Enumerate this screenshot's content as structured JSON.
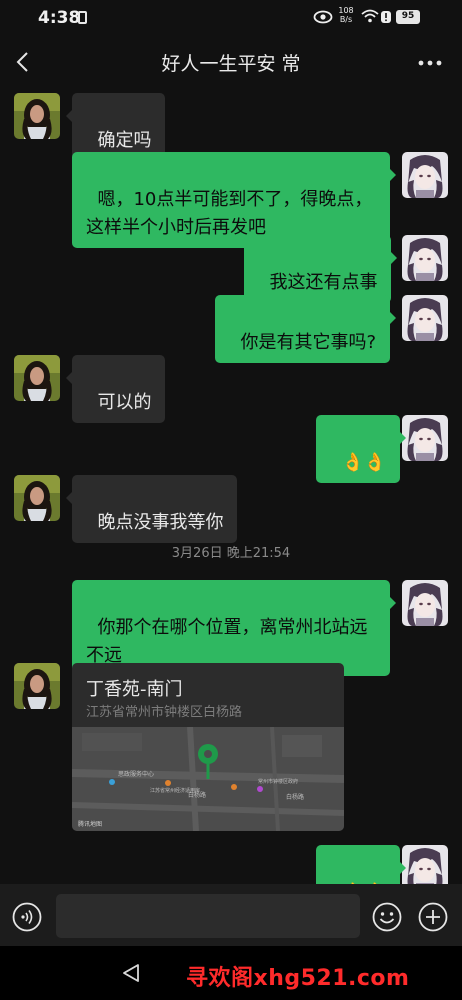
{
  "status_bar": {
    "time": "4:38",
    "net_speed_value": "108",
    "net_speed_unit": "B/s",
    "battery": "95"
  },
  "header": {
    "title": "好人一生平安 常"
  },
  "messages": [
    {
      "side": "in",
      "text": "确定吗"
    },
    {
      "side": "out",
      "text": "嗯，10点半可能到不了，得晚点，\n这样半个小时后再发吧"
    },
    {
      "side": "out",
      "text": "我这还有点事"
    },
    {
      "side": "out",
      "text": "你是有其它事吗?"
    },
    {
      "side": "in",
      "text": "可以的"
    },
    {
      "side": "out",
      "text": "👌👌"
    },
    {
      "side": "in",
      "text": "晚点没事我等你"
    },
    {
      "side": "out",
      "text": "你那个在哪个位置，离常州北站远\n不远"
    },
    {
      "side": "out",
      "text": "👌👌"
    }
  ],
  "timestamp": "3月26日 晚上21:54",
  "location": {
    "name": "丁香苑-南门",
    "address": "江苏省常州市钟楼区白杨路",
    "map_labels": [
      "思政服务中心",
      "江苏省常州经济适用房",
      "白杨路",
      "白杨路",
      "常州市钟楼区政府",
      "腾讯地图"
    ]
  },
  "watermark": "寻欢阁xhg521.com",
  "icons": [
    "back-arrow-icon",
    "more-icon",
    "voice-icon",
    "emoji-icon",
    "plus-icon",
    "nav-back-icon"
  ]
}
